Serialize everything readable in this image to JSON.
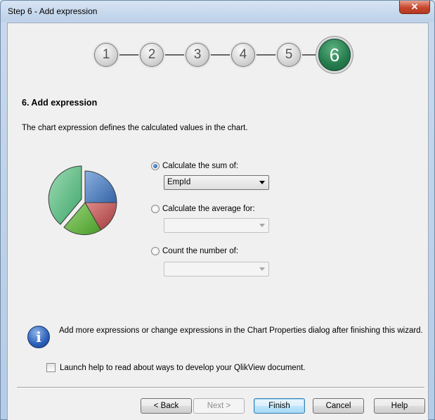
{
  "window": {
    "title": "Step 6 - Add expression",
    "close_glyph": "✕"
  },
  "stepper": {
    "steps": [
      "1",
      "2",
      "3",
      "4",
      "5",
      "6"
    ],
    "active": 6
  },
  "page": {
    "heading": "6. Add expression",
    "description": "The chart expression defines the calculated values in the chart."
  },
  "options": [
    {
      "label": "Calculate the sum of:",
      "checked": true,
      "combo_value": "EmpId",
      "enabled": true
    },
    {
      "label": "Calculate the average for:",
      "checked": false,
      "combo_value": "",
      "enabled": false
    },
    {
      "label": "Count the number of:",
      "checked": false,
      "combo_value": "",
      "enabled": false
    }
  ],
  "info": {
    "icon": "info-icon",
    "text": "Add more expressions or change expressions in the Chart Properties dialog after finishing this wizard."
  },
  "launch_help": {
    "label": "Launch help to read about ways to develop your QlikView document.",
    "checked": false
  },
  "buttons": {
    "back": "< Back",
    "next": "Next >",
    "finish": "Finish",
    "cancel": "Cancel",
    "help": "Help"
  },
  "colors": {
    "active_step": "#247a4c",
    "pie_green_light": "#5fbf85",
    "pie_blue": "#4a7ab8",
    "pie_red": "#b84a4a",
    "pie_green": "#5bb13b"
  }
}
